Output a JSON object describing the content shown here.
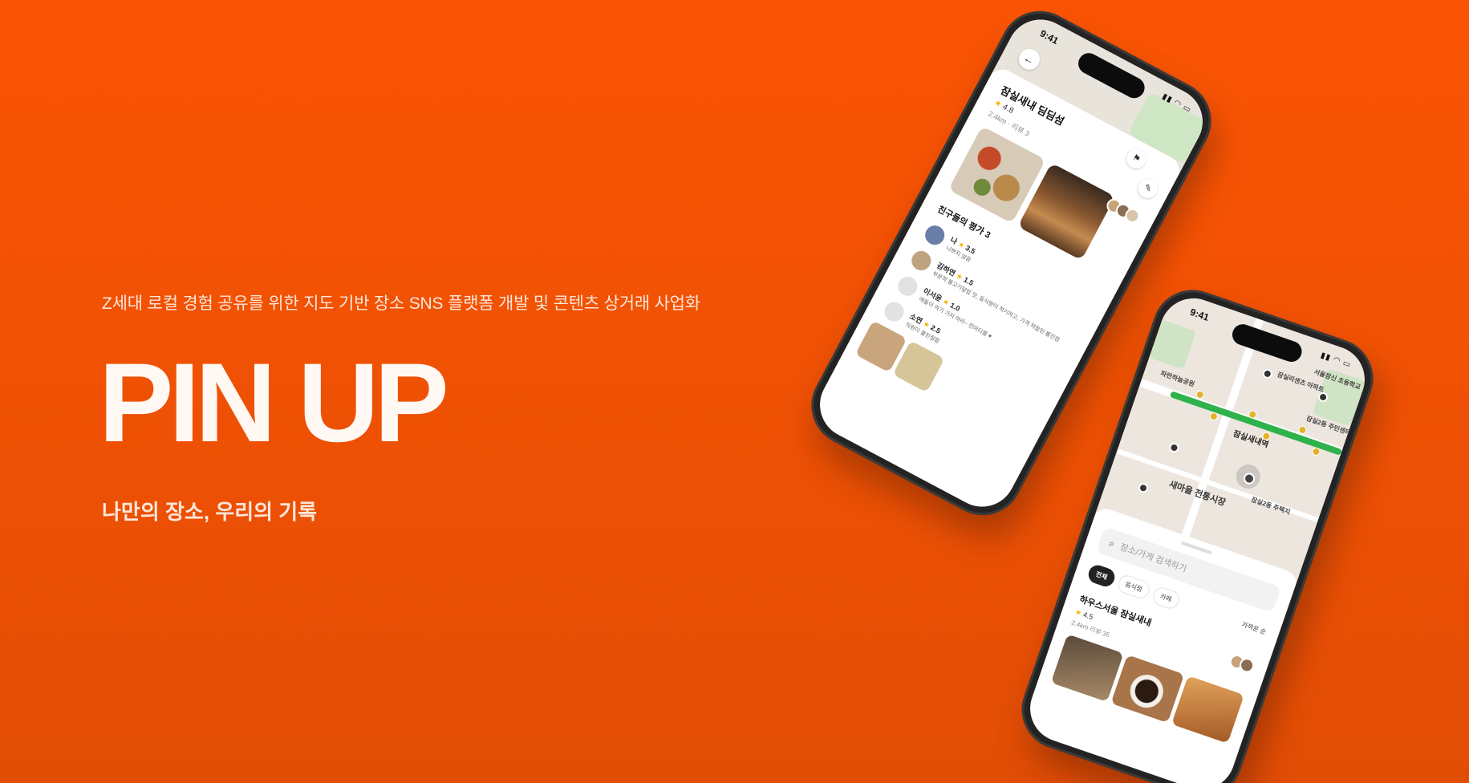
{
  "hero": {
    "subtitle": "Z세대 로컬 경험 공유를 위한 지도 기반 장소 SNS 플랫폼 개발 및 콘텐츠 상거래 사업화",
    "title": "PIN UP",
    "tagline": "나만의 장소, 우리의 기록"
  },
  "colors": {
    "background": "#fb5404",
    "accent_green": "#2fb24b",
    "star": "#f5b301"
  },
  "phone1": {
    "time": "9:41",
    "place": {
      "name": "잠실새내 딤딤섬",
      "rating": "4.8",
      "distance": "2.4km",
      "reviews": "리뷰 3"
    },
    "icons": [
      "back-arrow-icon",
      "bookmark-icon",
      "edit-icon"
    ],
    "friends_section": "친구들의 평가 3",
    "reviews": [
      {
        "name": "나",
        "rating": "3.5",
        "text": "나쁘지 않음"
      },
      {
        "name": "김하연",
        "rating": "1.5",
        "text": "부분적 불고기덮밥 맛, 음식량이 적기하고, 가격 적합된 볼진점"
      },
      {
        "name": "이서윤",
        "rating": "1.0",
        "text": "애들이 여기 가지 마라~ 한마디를 ♥"
      },
      {
        "name": "소연",
        "rating": "2.5",
        "text": "직원이 불친절함"
      }
    ]
  },
  "phone2": {
    "time": "9:41",
    "map": {
      "station_label": "잠실새내역",
      "market_label": "새마을 전통시장",
      "labels": [
        "잠실리센츠 아파트",
        "서울잠신 초등학교",
        "잠실2동 주민센터",
        "잠실2동 주택지",
        "파란하늘공원"
      ]
    },
    "search": {
      "placeholder": "장소/가게 검색하기"
    },
    "chips": [
      "전체",
      "음식점",
      "카페"
    ],
    "sort": "가까운 순",
    "listing": {
      "name": "하우스서울 잠실새내",
      "rating": "4.5",
      "distance": "2.4km",
      "reviews": "리뷰 35"
    }
  }
}
